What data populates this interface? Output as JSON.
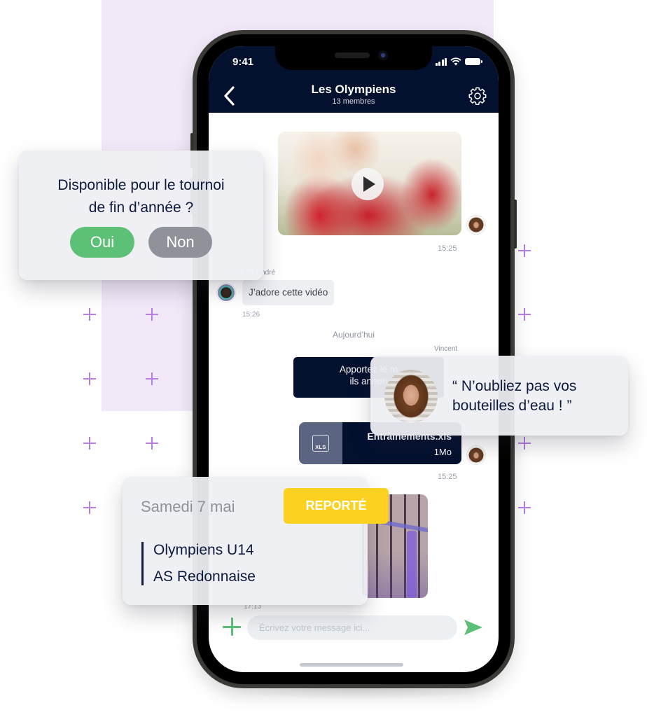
{
  "status_bar": {
    "time": "9:41"
  },
  "chat_header": {
    "title": "Les Olympiens",
    "subtitle": "13 membres",
    "back_icon": "chevron-left-icon",
    "settings_icon": "gear-icon"
  },
  "messages": {
    "video": {
      "time": "15:25",
      "play_icon": "play-icon"
    },
    "reaction": {
      "sender": "Julien Landré",
      "sender_visible": "en Landré",
      "text": "J’adore cette vidéo",
      "time": "15:26"
    },
    "day_separator": "Aujourd’hui",
    "announcement": {
      "sender": "Vincent",
      "line1": "Apportez le m",
      "line2": "ils annon"
    },
    "file": {
      "icon_label": "XLS",
      "name": "Entrainements.xls",
      "size": "1Mo",
      "time": "15:25"
    },
    "photo": {
      "time": "17:13"
    }
  },
  "composer": {
    "placeholder": "Écrivez votre message ici...",
    "add_icon": "plus-icon",
    "send_icon": "send-icon"
  },
  "poll_card": {
    "question_line1": "Disponible pour le tournoi",
    "question_line2": "de fin d’année ?",
    "yes_label": "Oui",
    "no_label": "Non",
    "colors": {
      "yes": "#5cc177",
      "no": "#8f9399"
    }
  },
  "quote_card": {
    "line1": "“ N’oubliez pas vos",
    "line2": "bouteilles d’eau ! ”"
  },
  "match_card": {
    "date": "Samedi 7 mai",
    "status": "REPORTÉ",
    "status_color": "#fdd11f",
    "team_home": "Olympiens U14",
    "team_away": "AS Redonnaise"
  },
  "theme": {
    "header_bg": "#03102e",
    "accent_green": "#5cc177",
    "decor_purple": "#b77fe0",
    "bg_lilac": "#f1e9f8"
  }
}
